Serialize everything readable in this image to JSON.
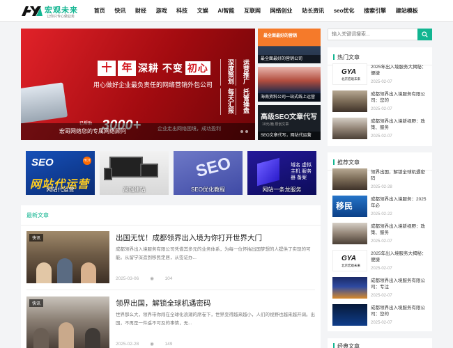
{
  "logo": {
    "text": "宏观未来",
    "sub": "让你只专心做业务",
    "mark": "宏观未来-logo-mark"
  },
  "nav": [
    "首页",
    "快讯",
    "财经",
    "游戏",
    "科技",
    "文娱",
    "AI智能",
    "互联网",
    "网络创业",
    "站长资讯",
    "seo优化",
    "搜索引擎",
    "建站模板"
  ],
  "slider": {
    "badge1": "十",
    "badge2": "年",
    "headline": "深耕 不变",
    "headline_em": "初心",
    "sub": "用心做好企业最负责任的网络营销外包公司",
    "big_pre": "已帮助",
    "big": "3000+",
    "big_suffix": "企业走出网络困境，成功盈利",
    "vertical": [
      "运营推广",
      "托管操盘",
      "深度策划",
      "每天汇报"
    ],
    "caption": "宏哥网络您的专属网络顾问"
  },
  "side_tiles": [
    {
      "label": "最全面最好的营销",
      "caption": "最全面最好的营销公司"
    },
    {
      "label": "",
      "caption": "海南资料公司一站式线上运营"
    },
    {
      "label": "高级SEO文章代写",
      "sub": "10元/篇 原创文章",
      "caption": "SEO文章代写，网站代运营"
    }
  ],
  "promos": [
    {
      "caption": "网站代运营",
      "a": "SEO",
      "b": "网站代运营",
      "hot": "HOT"
    },
    {
      "caption": "高端建站"
    },
    {
      "caption": "SEO优化教程",
      "a": "SEO"
    },
    {
      "caption": "网站一条龙服务",
      "a": "域名 虚拟主机 服务器 备案"
    }
  ],
  "latest": {
    "title": "最新文章",
    "articles": [
      {
        "tag": "快讯",
        "title": "出国无忧！成都领界出入境为你打开世界大门",
        "desc": "成都领界出入境服务有限公司凭借其多元的业务体系，为每一位怀揣出国梦想的人提供了实现的可能。从留学深造到移民定居，从签证办...",
        "date": "2025-03-06",
        "views": "104"
      },
      {
        "tag": "快讯",
        "title": "领界出国，解锁全球机遇密码",
        "desc": "世界那么大，领界带你闯在全球化浪潮的席卷下，世界变得越来越小，人们的视野也越来越开阔。出国，不再是一件遥不可及的事情，无...",
        "date": "2025-02-28",
        "views": "149"
      }
    ]
  },
  "search": {
    "placeholder": "输入关键词搜索..."
  },
  "hot": {
    "title": "热门文章",
    "items": [
      {
        "title": "2025年出入境服务大揭秘：便捷",
        "date": "2025-02-07",
        "thumb_text": "GYA",
        "thumb_sub": "北京宏观未来"
      },
      {
        "title": "成都领界出入境服务有限公司：您的",
        "date": "2025-02-07"
      },
      {
        "title": "成都领界出入境新视野：政策、服务",
        "date": "2025-02-07"
      }
    ]
  },
  "recommend": {
    "title": "推荐文章",
    "items": [
      {
        "title": "领界出国，解锁全球机遇密码",
        "date": "2025-02-28"
      },
      {
        "title": "成都领界出入境服务：2025年必",
        "date": "2025-02-22",
        "thumb_text": "移民"
      },
      {
        "title": "成都领界出入境新视野：政策、服务",
        "date": "2025-02-07"
      },
      {
        "title": "2025年出入境服务大揭秘：便捷",
        "date": "2025-02-07",
        "thumb_text": "GYA",
        "thumb_sub": "北京宏观未来"
      },
      {
        "title": "成都领界出入境服务有限公司：专注",
        "date": "2025-02-07"
      },
      {
        "title": "成都领界出入境服务有限公司：您的",
        "date": "2025-02-07"
      }
    ]
  },
  "classic": {
    "title": "经典文章"
  },
  "colors": {
    "accent": "#12b591",
    "banner_red": "#d3151c"
  },
  "icons": {
    "search": "search-icon"
  }
}
